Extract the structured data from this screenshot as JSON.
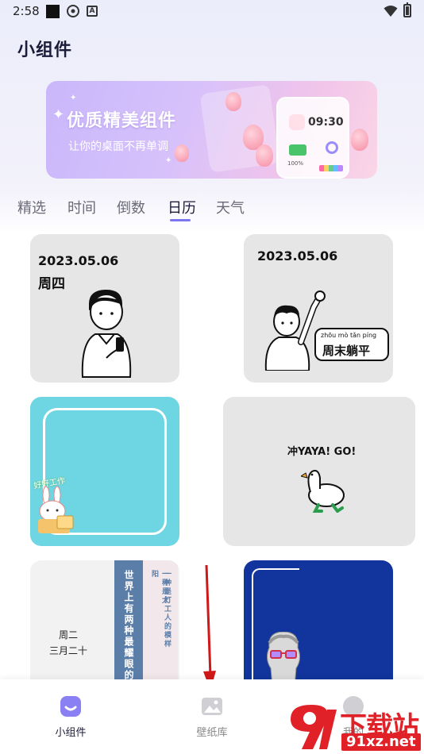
{
  "status_bar": {
    "time": "2:58",
    "a_icon": "A"
  },
  "header": {
    "title": "小组件"
  },
  "banner": {
    "title": "优质精美组件",
    "subtitle": "让你的桌面不再单调",
    "widget_time": "09:30",
    "widget_battery": "100%"
  },
  "tabs": [
    {
      "label": "精选"
    },
    {
      "label": "时间"
    },
    {
      "label": "倒数"
    },
    {
      "label": "日历",
      "active": true
    },
    {
      "label": "天气"
    }
  ],
  "cards": {
    "card1": {
      "date": "2023.05.06",
      "weekday": "周四"
    },
    "card2": {
      "date": "2023.05.06",
      "pinyin": "zhōu mò  tǎn píng",
      "badge": "周末躺平"
    },
    "card3": {
      "label": "好好工作"
    },
    "card4": {
      "text": "冲YAYA! GO!"
    },
    "card5": {
      "weekday": "周二",
      "lunar": "三月二十",
      "vertical_main": "世界上有两种最耀眼的",
      "vertical_a": "一种是太阳",
      "vertical_b": "一种是打工人的模样"
    }
  },
  "bottom_nav": [
    {
      "label": "小组件",
      "icon": "widget-icon",
      "active": true
    },
    {
      "label": "壁纸库",
      "icon": "wallpaper-icon"
    },
    {
      "label": "我的",
      "icon": "profile-icon"
    }
  ],
  "watermark": {
    "title": "下载站",
    "url": "91xz.net"
  },
  "colors": {
    "accent": "#7d74f0",
    "banner": "#d6c1fb",
    "cyan_card": "#6ed6e2",
    "blue_card": "#11359c",
    "watermark": "#e02127"
  }
}
